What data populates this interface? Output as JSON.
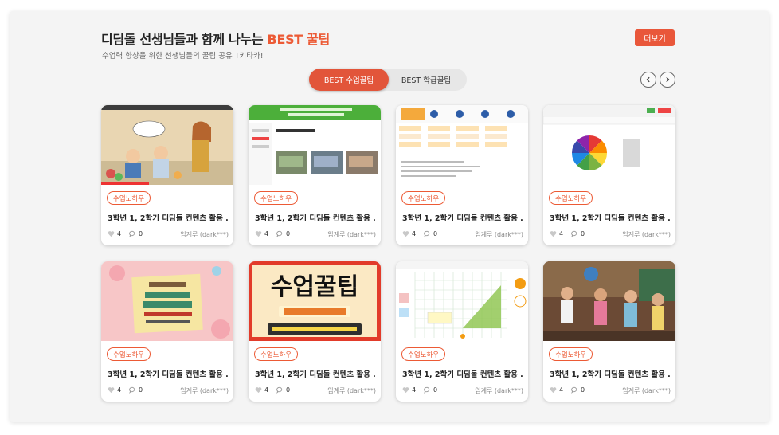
{
  "header": {
    "title_main": "디딤돌 선생님들과 함께 나누는 ",
    "title_accent": "BEST 꿀팁",
    "subtitle": "수업력 향상을 위한 선생님들의 꿀팁 공유 T키타카!",
    "more_label": "더보기"
  },
  "tabs": [
    {
      "label": "BEST 수업꿀팁",
      "active": true
    },
    {
      "label": "BEST 학급꿀팁",
      "active": false
    }
  ],
  "nav": {
    "prev_icon": "chevron-left-icon",
    "next_icon": "chevron-right-icon"
  },
  "colors": {
    "accent": "#ec5a35",
    "button": "#e9573a",
    "panel": "#f4f4f4"
  },
  "cards": [
    {
      "tag": "수업노하우",
      "title": "3학년 1, 2학기 디딤돌 컨텐츠 활용 ...",
      "likes": "4",
      "comments": "0",
      "author": "임계루 (dark***)",
      "thumb": "illustration-children-teacher",
      "thumb_text": ""
    },
    {
      "tag": "수업노하우",
      "title": "3학년 1, 2학기 디딤돌 컨텐츠 활용 ...",
      "likes": "4",
      "comments": "0",
      "author": "임계루 (dark***)",
      "thumb": "web-screenshot-green",
      "thumb_text": ""
    },
    {
      "tag": "수업노하우",
      "title": "3학년 1, 2학기 디딤돌 컨텐츠 활용 ...",
      "likes": "4",
      "comments": "0",
      "author": "임계루 (dark***)",
      "thumb": "flowchart-screenshot",
      "thumb_text": ""
    },
    {
      "tag": "수업노하우",
      "title": "3학년 1, 2학기 디딤돌 컨텐츠 활용 ...",
      "likes": "4",
      "comments": "0",
      "author": "임계루 (dark***)",
      "thumb": "fraction-wheel-screenshot",
      "thumb_text": ""
    },
    {
      "tag": "수업노하우",
      "title": "3학년 1, 2학기 디딤돌 컨텐츠 활용 ...",
      "likes": "4",
      "comments": "0",
      "author": "임계루 (dark***)",
      "thumb": "pink-poster",
      "thumb_text": ""
    },
    {
      "tag": "수업노하우",
      "title": "3학년 1, 2학기 디딤돌 컨텐츠 활용 ...",
      "likes": "4",
      "comments": "0",
      "author": "임계루 (dark***)",
      "thumb": "lesson-tip-banner",
      "thumb_text": "수업꿀팁"
    },
    {
      "tag": "수업노하우",
      "title": "3학년 1, 2학기 디딤돌 컨텐츠 활용 ...",
      "likes": "4",
      "comments": "0",
      "author": "임계루 (dark***)",
      "thumb": "grid-geometry-screenshot",
      "thumb_text": ""
    },
    {
      "tag": "수업노하우",
      "title": "3학년 1, 2학기 디딤돌 컨텐츠 활용 ...",
      "likes": "4",
      "comments": "0",
      "author": "임계루 (dark***)",
      "thumb": "classroom-photo",
      "thumb_text": ""
    }
  ]
}
